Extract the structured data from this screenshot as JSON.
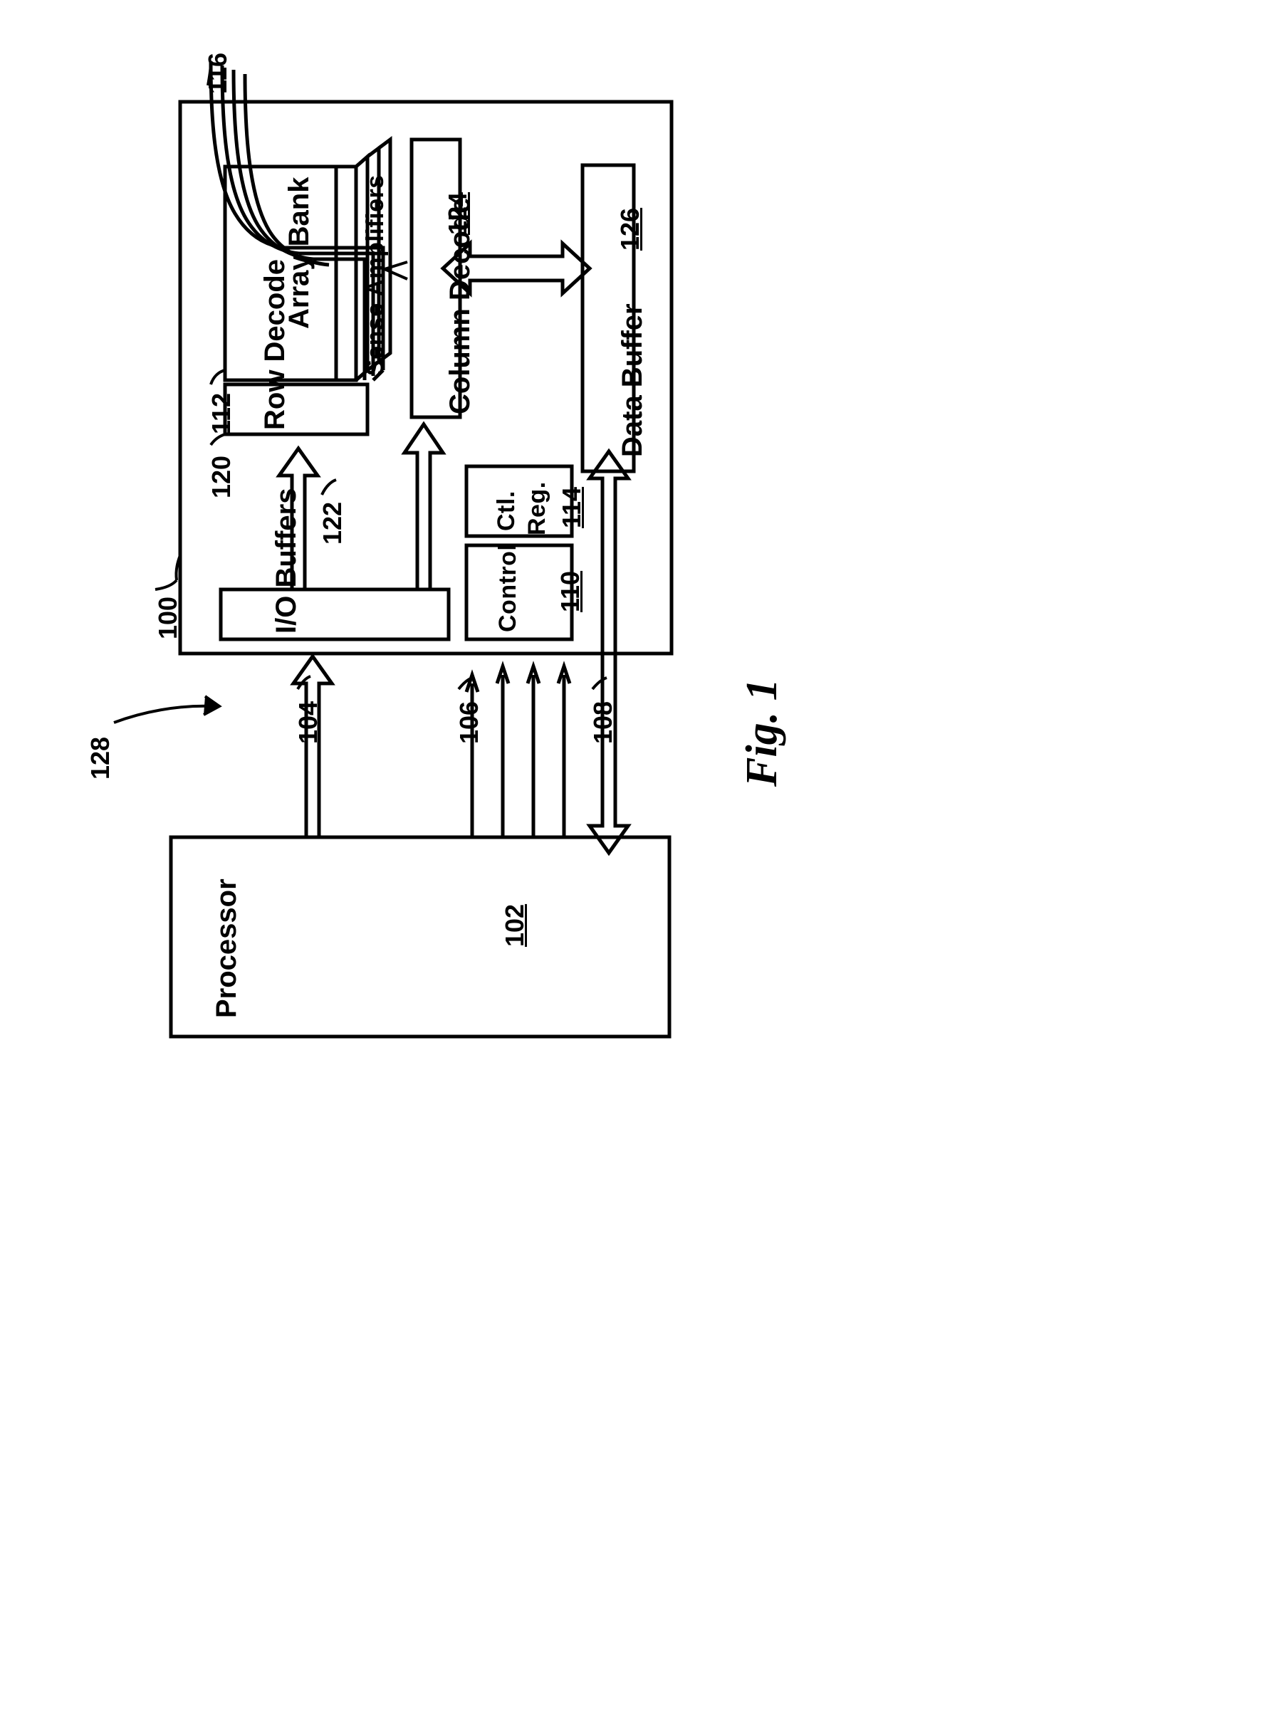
{
  "figure": {
    "caption": "Fig. 1",
    "system_ref": "128"
  },
  "memory_device": {
    "ref": "100",
    "array_bank": {
      "label": "Array Bank",
      "ref": "112",
      "stack_count": 4
    },
    "sense_amplifiers": {
      "label": "Sense Amplifiers",
      "ref": "122"
    },
    "row_decode": {
      "label": "Row Decode",
      "ref": "120"
    },
    "column_decode": {
      "label": "Column Decode",
      "ref": "124"
    },
    "data_buffer": {
      "label": "Data Buffer",
      "ref": "126"
    },
    "control": {
      "label": "Control",
      "ref": "110"
    },
    "ctl_reg": {
      "label_line1": "Ctl.",
      "label_line2": "Reg.",
      "ref": "114"
    },
    "io_buffers": {
      "label": "I/O Buffers"
    },
    "bank_select_lines": {
      "ref": "116"
    }
  },
  "processor": {
    "label": "Processor",
    "ref": "102"
  },
  "buses": {
    "address_bus": {
      "ref": "104"
    },
    "control_bus": {
      "ref": "106"
    },
    "data_bus": {
      "ref": "108"
    }
  },
  "style": {
    "ink": "#000000",
    "paper": "#ffffff"
  }
}
